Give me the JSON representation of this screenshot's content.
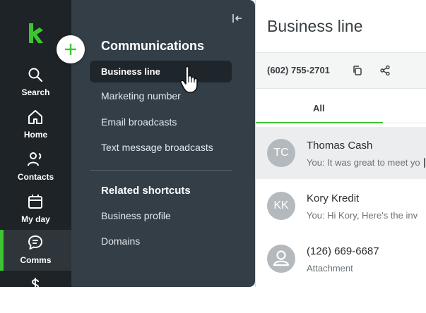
{
  "rail": {
    "logo": "keap-k-logo",
    "items": [
      {
        "label": "Search",
        "icon": "search-icon"
      },
      {
        "label": "Home",
        "icon": "home-icon"
      },
      {
        "label": "Contacts",
        "icon": "contacts-icon"
      },
      {
        "label": "My day",
        "icon": "calendar-icon"
      },
      {
        "label": "Comms",
        "icon": "chat-bubble-icon",
        "active": true
      },
      {
        "label": "",
        "icon": "dollar-icon"
      }
    ]
  },
  "flyout": {
    "heading": "Communications",
    "items": [
      "Business line",
      "Marketing number",
      "Email broadcasts",
      "Text message broadcasts"
    ],
    "selected": "Business line",
    "related_heading": "Related shortcuts",
    "related_items": [
      "Business profile",
      "Domains"
    ]
  },
  "main": {
    "title": "Business line",
    "phone": "(602) 755-2701",
    "tab": "All",
    "conversations": [
      {
        "initials": "TC",
        "name": "Thomas Cash",
        "preview": "You: It was great to meet yo",
        "selected": true
      },
      {
        "initials": "KK",
        "name": "Kory Kredit",
        "preview": "You: Hi Kory, Here's the inv"
      },
      {
        "initials": "",
        "name": "(126) 669-6687",
        "preview": "Attachment"
      }
    ]
  },
  "colors": {
    "accent": "#3ec431",
    "rail": "#1d2327",
    "flyout": "#333e47"
  }
}
